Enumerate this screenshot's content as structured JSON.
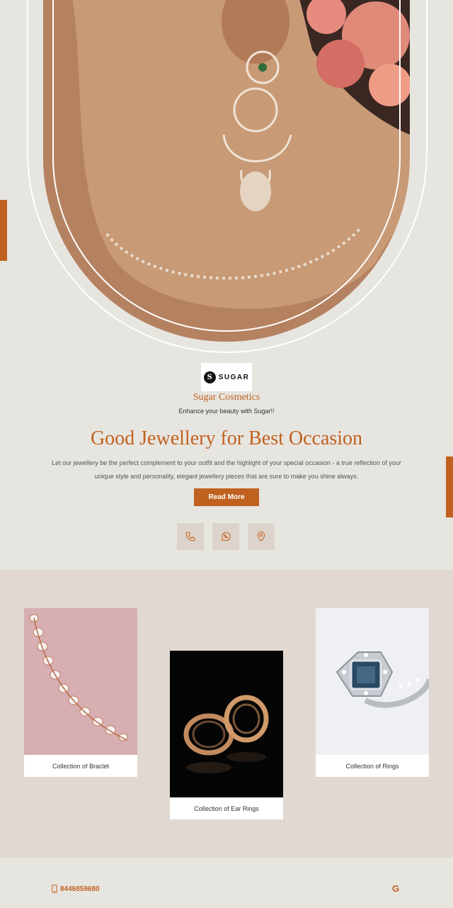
{
  "brand": {
    "logo_text": "SUGAR",
    "logo_mark": "S",
    "name": "Sugar Cosmetics",
    "tagline": "Enhance your beauty with Sugar!!"
  },
  "hero": {
    "headline": "Good Jewellery for Best Occasion",
    "description": "Let our jewellery be the perfect complement to your outfit and the highlight of your special occasion - a true reflection of your unique style and personality, elegant jewellery pieces that are sure to make you shine always.",
    "cta_label": "Read More",
    "contact_icons": [
      "phone-icon",
      "whatsapp-icon",
      "location-icon"
    ]
  },
  "collections": [
    {
      "label": "Collection of Braclet"
    },
    {
      "label": "Collection of Ear Rings"
    },
    {
      "label": "Collection of Rings"
    }
  ],
  "footer": {
    "phone": "8446859680",
    "social_icon": "google-icon",
    "social_glyph": "G"
  },
  "colors": {
    "accent": "#c0611f",
    "background": "#e7e5e0",
    "collections_background": "#e1d9d1",
    "icon_tile": "#dcd4cc"
  }
}
